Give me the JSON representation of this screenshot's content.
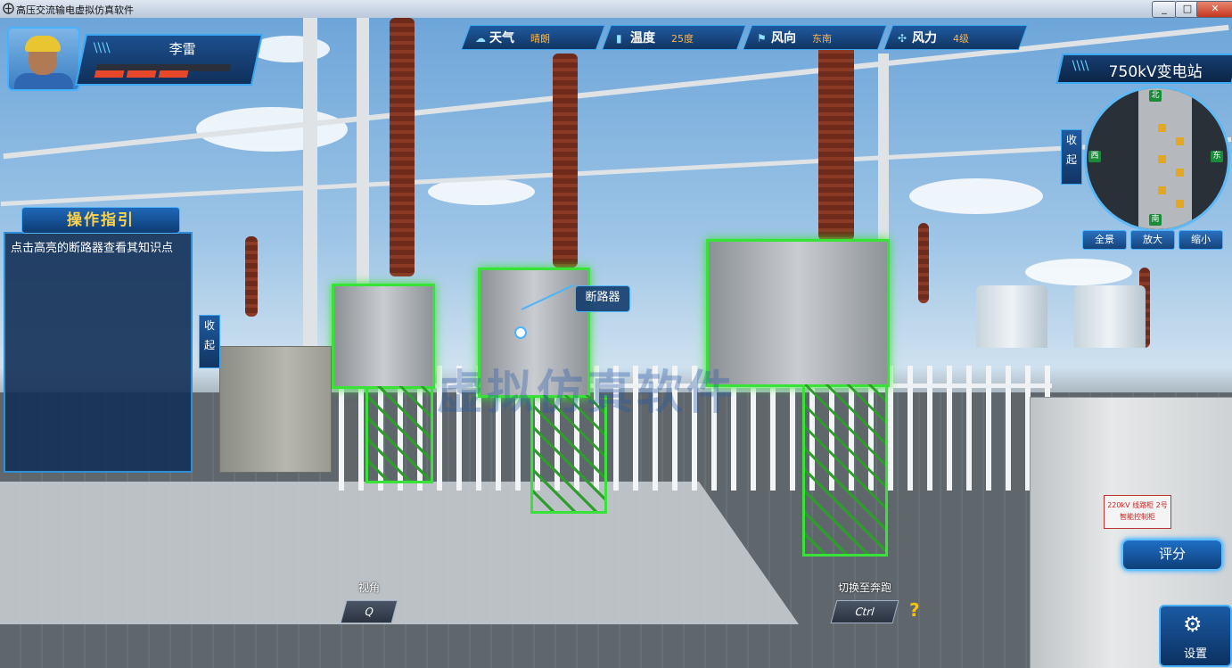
{
  "window": {
    "title": "高压交流输电虚拟仿真软件",
    "controls": {
      "minimize": "_",
      "maximize": "□",
      "close": "✕"
    }
  },
  "player": {
    "name": "李雷",
    "avatar_icon": "worker-avatar-icon"
  },
  "weather_bar": [
    {
      "icon": "weather-icon",
      "label": "天气",
      "value": "晴朗"
    },
    {
      "icon": "thermometer-icon",
      "label": "温度",
      "value": "25度"
    },
    {
      "icon": "wind-direction-icon",
      "label": "风向",
      "value": "东南"
    },
    {
      "icon": "wind-force-icon",
      "label": "风力",
      "value": "4级"
    }
  ],
  "station": {
    "name": "750kV变电站"
  },
  "minimap": {
    "collapse_label": "收起",
    "compass": {
      "north": "北",
      "south": "南",
      "east": "东",
      "west": "西"
    },
    "controls": {
      "full": "全景",
      "zoom_in": "放大",
      "zoom_out": "缩小"
    }
  },
  "guide": {
    "title": "操作指引",
    "text": "点击高亮的断路器查看其知识点",
    "collapse_label": "收起"
  },
  "scene": {
    "breaker_tag": "断路器",
    "watermark": "虚拟仿真软件",
    "cabinet_label": "220kV 线路柜 2号智能控制柜"
  },
  "key_hints": {
    "view": {
      "label": "视角",
      "key": "Q"
    },
    "run": {
      "label": "切换至奔跑",
      "key": "Ctrl"
    },
    "help_icon": "?"
  },
  "buttons": {
    "score": "评分",
    "settings": "设置"
  },
  "colors": {
    "accent": "#2f8fd6",
    "highlight": "#39e236",
    "warning": "#ffb54a"
  }
}
